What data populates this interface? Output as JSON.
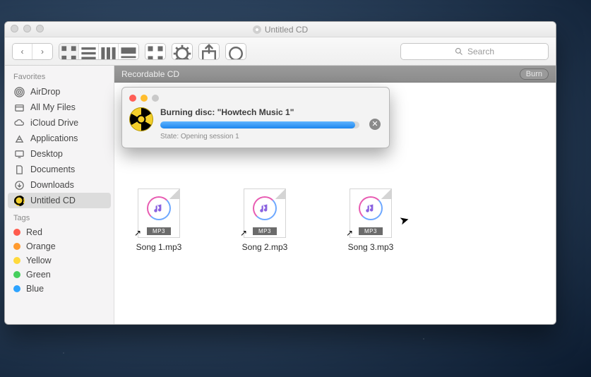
{
  "window": {
    "title": "Untitled CD"
  },
  "toolbar": {
    "search_placeholder": "Search"
  },
  "sidebar": {
    "favorites_label": "Favorites",
    "tags_label": "Tags",
    "items": [
      {
        "label": "AirDrop"
      },
      {
        "label": "All My Files"
      },
      {
        "label": "iCloud Drive"
      },
      {
        "label": "Applications"
      },
      {
        "label": "Desktop"
      },
      {
        "label": "Documents"
      },
      {
        "label": "Downloads"
      },
      {
        "label": "Untitled CD"
      }
    ],
    "tags": [
      {
        "label": "Red",
        "color": "#ff5b4d"
      },
      {
        "label": "Orange",
        "color": "#ff9a2e"
      },
      {
        "label": "Yellow",
        "color": "#ffd93b"
      },
      {
        "label": "Green",
        "color": "#46cf5d"
      },
      {
        "label": "Blue",
        "color": "#2da3ff"
      }
    ]
  },
  "path_bar": {
    "label": "Recordable CD",
    "burn_button": "Burn"
  },
  "files": [
    {
      "name": "Song 1.mp3",
      "badge": "MP3"
    },
    {
      "name": "Song 2.mp3",
      "badge": "MP3"
    },
    {
      "name": "Song 3.mp3",
      "badge": "MP3"
    }
  ],
  "dialog": {
    "title": "Burning disc: \"Howtech Music 1\"",
    "state": "State: Opening session 1",
    "progress_percent": 98,
    "traffic": {
      "close": "#ff5f57",
      "min": "#ffbd2e",
      "max": "#c9c9c9"
    }
  }
}
